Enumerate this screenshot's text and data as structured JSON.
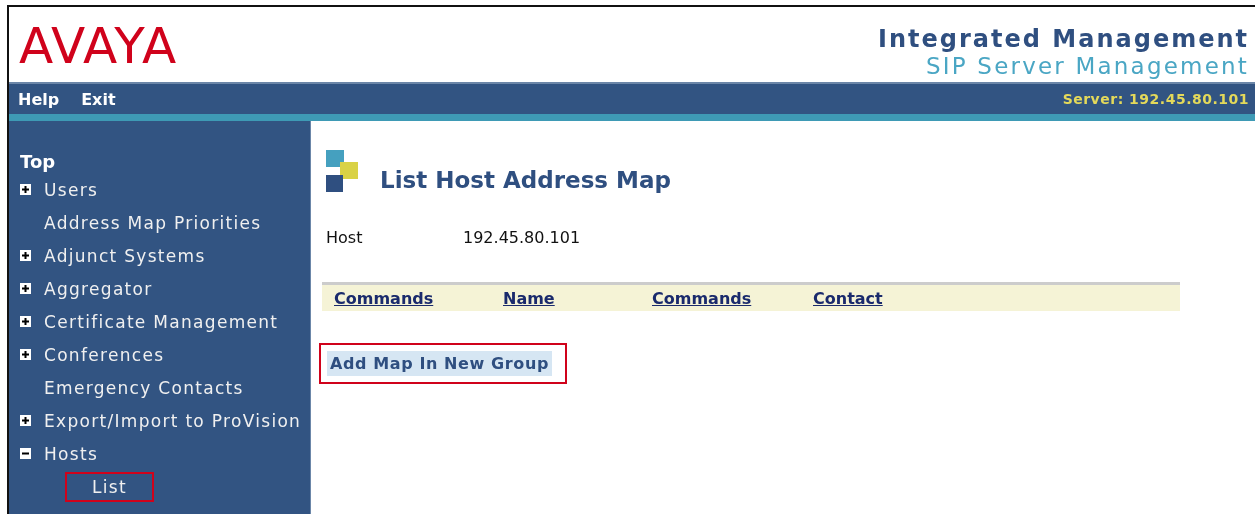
{
  "header": {
    "logo": "AVAYA",
    "title": "Integrated Management",
    "subtitle": "SIP Server Management"
  },
  "menu_bar": {
    "items": [
      "Help",
      "Exit"
    ],
    "server": "Server: 192.45.80.101"
  },
  "sidebar": {
    "heading": "Top",
    "items": [
      {
        "label": "Users",
        "kind": "folder",
        "expanded": false
      },
      {
        "label": "Address Map Priorities",
        "kind": "link"
      },
      {
        "label": "Adjunct Systems",
        "kind": "folder",
        "expanded": false
      },
      {
        "label": "Aggregator",
        "kind": "folder",
        "expanded": false
      },
      {
        "label": "Certificate Management",
        "kind": "folder",
        "expanded": false
      },
      {
        "label": "Conferences",
        "kind": "folder",
        "expanded": false
      },
      {
        "label": "Emergency Contacts",
        "kind": "link"
      },
      {
        "label": "Export/Import to ProVision",
        "kind": "folder",
        "expanded": false
      },
      {
        "label": "Hosts",
        "kind": "folder",
        "expanded": true,
        "children": [
          {
            "label": "List",
            "kind": "link",
            "highlighted": true
          }
        ]
      }
    ]
  },
  "page": {
    "title": "List Host Address Map",
    "host_label": "Host",
    "host_value": "192.45.80.101",
    "table": {
      "columns": [
        "Commands",
        "Name",
        "Commands",
        "Contact"
      ]
    },
    "action": {
      "label": "Add Map In New Group",
      "highlighted": true
    }
  }
}
